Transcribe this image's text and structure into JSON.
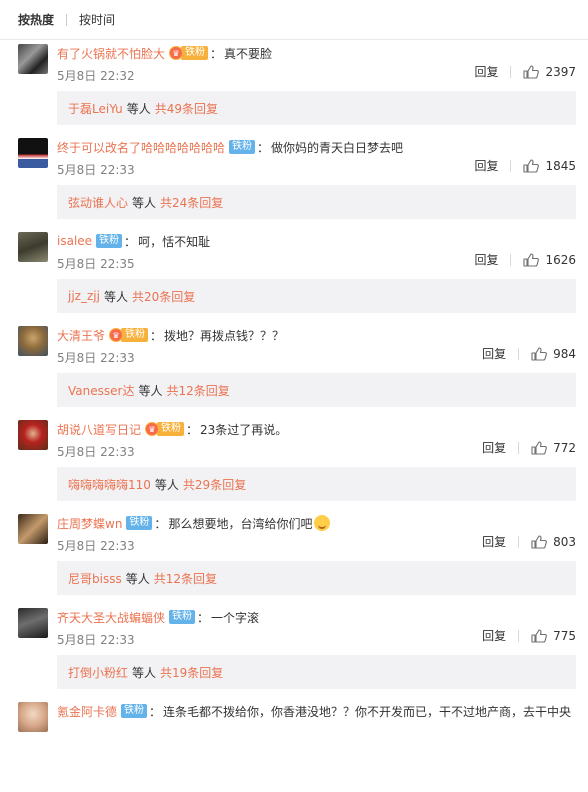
{
  "sort": {
    "hot": "按热度",
    "time": "按时间"
  },
  "labels": {
    "reply": "回复",
    "sub_mid": "等人",
    "colon": "："
  },
  "colors": {
    "link": "#eb7350",
    "badge_blue": "#63b2e9",
    "badge_gold": "#f7b03a",
    "meta": "#808080",
    "sub_bg": "#f2f2f5"
  },
  "comments": [
    {
      "user": "有了火锅就不怕脸大",
      "badge": "铁粉",
      "badge_style": "gold-crown",
      "text": "真不要脸",
      "time": "5月8日 22:32",
      "likes": "2397",
      "sub_user": "于磊LeiYu",
      "sub_count": "共49条回复"
    },
    {
      "user": "终于可以改名了哈哈哈哈哈哈哈",
      "badge": "铁粉",
      "badge_style": "blue",
      "text": "做你妈的青天白日梦去吧",
      "time": "5月8日 22:33",
      "likes": "1845",
      "sub_user": "弦动谁人心",
      "sub_count": "共24条回复"
    },
    {
      "user": "isalee",
      "badge": "铁粉",
      "badge_style": "blue",
      "text": "呵，恬不知耻",
      "time": "5月8日 22:35",
      "likes": "1626",
      "sub_user": "jjz_zjj",
      "sub_count": "共20条回复"
    },
    {
      "user": "大清王爷",
      "badge": "铁粉",
      "badge_style": "gold-crown",
      "text": "拨地？再拨点钱？？？",
      "time": "5月8日 22:33",
      "likes": "984",
      "sub_user": "Vanesser达",
      "sub_count": "共12条回复"
    },
    {
      "user": "胡说八道写日记",
      "badge": "铁粉",
      "badge_style": "gold-crown",
      "text": "23条过了再说。",
      "time": "5月8日 22:33",
      "likes": "772",
      "sub_user": "嗨嗨嗨嗨嗨110",
      "sub_count": "共29条回复"
    },
    {
      "user": "庄周梦蝶wn",
      "badge": "铁粉",
      "badge_style": "blue",
      "text": "那么想要地，台湾给你们吧",
      "time": "5月8日 22:33",
      "likes": "803",
      "sub_user": "尼哥bisss",
      "sub_count": "共12条回复",
      "has_emoji": true
    },
    {
      "user": "齐天大圣大战蝙蝠侠",
      "badge": "铁粉",
      "badge_style": "blue",
      "text": "一个字滚",
      "time": "5月8日 22:33",
      "likes": "775",
      "sub_user": "打倒小粉红",
      "sub_count": "共19条回复"
    },
    {
      "user": "氪金阿卡德",
      "badge": "铁粉",
      "badge_style": "blue",
      "text": "连条毛都不拨给你，你香港没地？？你不开发而已，干不过地产商，去干中央"
    }
  ]
}
